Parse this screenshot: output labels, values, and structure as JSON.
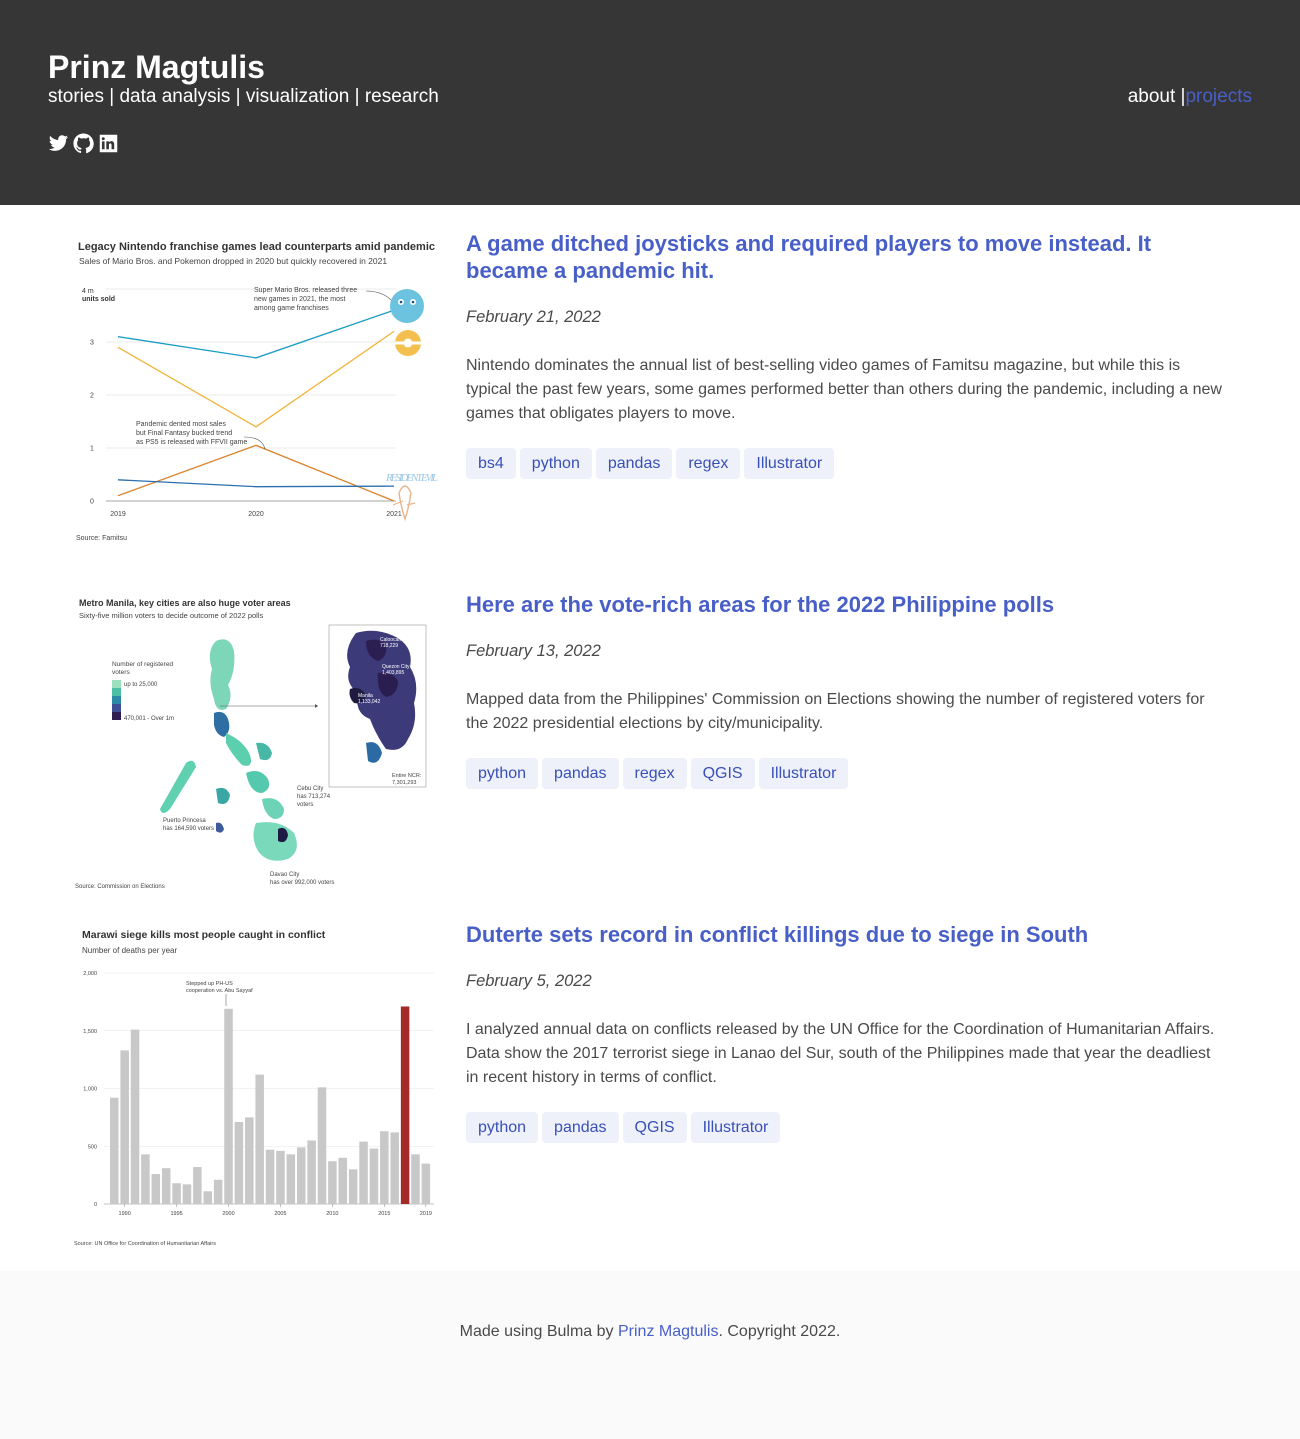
{
  "header": {
    "title": "Prinz Magtulis",
    "subtitle": "stories | data analysis | visualization | research",
    "nav": {
      "about": "about |",
      "projects": "projects"
    },
    "social_icons": [
      "twitter-icon",
      "github-icon",
      "linkedin-icon"
    ]
  },
  "posts": [
    {
      "title": "A game ditched joysticks and required players to move instead. It became a pandemic hit.",
      "date": "February 21, 2022",
      "description": "Nintendo dominates the annual list of best-selling video games of Famitsu magazine, but while this is typical the past few years, some games performed better than others during the pandemic, including a new games that obligates players to move.",
      "tags": [
        "bs4",
        "python",
        "pandas",
        "regex",
        "Illustrator"
      ],
      "thumbnail": {
        "title": "Legacy Nintendo franchise games lead counterparts amid pandemic",
        "subtitle": "Sales of Mario Bros. and Pokemon dropped in 2020 but quickly recovered in 2021",
        "ylabel_top": "4 m",
        "ylabel_unit": "units sold",
        "yticks": [
          "3",
          "2",
          "1",
          "0"
        ],
        "xticks": [
          "2019",
          "2020",
          "2021"
        ],
        "annotation_mario_1": "Super Mario Bros. released three",
        "annotation_mario_2": "new games in 2021, the most",
        "annotation_mario_3": "among game franchises",
        "annotation_ff_1": "Pandemic dented most sales",
        "annotation_ff_2": "but Final Fantasy bucked trend",
        "annotation_ff_3": "as PS5 is released with FFVII game",
        "logo_text": "RESIDENT EVIL",
        "source": "Source: Famitsu"
      }
    },
    {
      "title": "Here are the vote-rich areas for the 2022 Philippine polls",
      "date": "February 13, 2022",
      "description": "Mapped data from the Philippines' Commission on Elections showing the number of registered voters for the 2022 presidential elections by city/municipality.",
      "tags": [
        "python",
        "pandas",
        "regex",
        "QGIS",
        "Illustrator"
      ],
      "thumbnail": {
        "title": "Metro Manila, key cities are also huge voter areas",
        "subtitle": "Sixty-five million voters to decide outcome of 2022 polls",
        "legend_title_1": "Number of registered",
        "legend_title_2": "voters",
        "legend_low": "up to 25,000",
        "legend_high": "470,001 - Over 1m",
        "label_caloocan_1": "Caloocan",
        "label_caloocan_2": "718,229",
        "label_qc_1": "Quezon City",
        "label_qc_2": "1,403,895",
        "label_manila_1": "Manila",
        "label_manila_2": "1,133,042",
        "label_ncr_1": "Entire NCR:",
        "label_ncr_2": "7,301,293",
        "label_cebu_1": "Cebu City",
        "label_cebu_2": "has 713,274",
        "label_cebu_3": "voters",
        "label_puerto_1": "Puerto Princesa",
        "label_puerto_2": "has 164,590 voters",
        "label_davao_1": "Davao City",
        "label_davao_2": "has over 992,000 voters",
        "source": "Source: Commission on Elections"
      }
    },
    {
      "title": "Duterte sets record in conflict killings due to siege in South",
      "date": "February 5, 2022",
      "description": "I analyzed annual data on conflicts released by the UN Office for the Coordination of Humanitarian Affairs. Data show the 2017 terrorist siege in Lanao del Sur, south of the Philippines made that year the deadliest in recent history in terms of conflict.",
      "tags": [
        "python",
        "pandas",
        "QGIS",
        "Illustrator"
      ],
      "thumbnail": {
        "title": "Marawi siege kills most people caught in conflict",
        "subtitle": "Number of deaths per year",
        "annotation_1": "Stepped up PH-US",
        "annotation_2": "cooperation vs. Abu Sayyaf",
        "source": "Source: UN Office for Coordination of Humanitarian Affairs"
      }
    }
  ],
  "chart_data": [
    {
      "type": "line",
      "title": "Legacy Nintendo franchise games lead counterparts amid pandemic",
      "subtitle": "Sales of Mario Bros. and Pokemon dropped in 2020 but quickly recovered in 2021",
      "ylabel": "4 m units sold",
      "x": [
        "2019",
        "2020",
        "2021"
      ],
      "ylim": [
        0,
        4
      ],
      "series": [
        {
          "values": [
            3.1,
            2.7,
            3.6
          ],
          "color": "#1a9cc4"
        },
        {
          "values": [
            2.9,
            1.4,
            3.2
          ],
          "color": "#f0b43a"
        },
        {
          "values": [
            0.1,
            1.05,
            0.0
          ],
          "color": "#d9822b"
        },
        {
          "values": [
            0.4,
            0.27,
            0.28
          ],
          "color": "#2b6fb0"
        }
      ]
    },
    {
      "type": "bar",
      "title": "Marawi siege kills most people caught in conflict",
      "subtitle": "Number of deaths per year",
      "categories": [
        "1989",
        "1990",
        "1991",
        "1992",
        "1993",
        "1994",
        "1995",
        "1996",
        "1997",
        "1998",
        "1999",
        "2000",
        "2001",
        "2002",
        "2003",
        "2004",
        "2005",
        "2006",
        "2007",
        "2008",
        "2009",
        "2010",
        "2011",
        "2012",
        "2013",
        "2014",
        "2015",
        "2016",
        "2017",
        "2018",
        "2019"
      ],
      "values": [
        920,
        1330,
        1510,
        430,
        260,
        310,
        180,
        170,
        320,
        110,
        210,
        1690,
        710,
        750,
        1120,
        470,
        460,
        430,
        490,
        550,
        1010,
        370,
        400,
        300,
        540,
        480,
        630,
        620,
        1710,
        430,
        350
      ],
      "highlight_index": 28,
      "ylim": [
        0,
        2000
      ],
      "yticks": [
        "0",
        "500",
        "1,000",
        "1,500",
        "2,000"
      ],
      "xticks": [
        "1990",
        "1995",
        "2000",
        "2005",
        "2010",
        "2015",
        "2019"
      ],
      "bar_color": "#c8c8c8",
      "highlight_color": "#a42a2a"
    }
  ],
  "footer": {
    "prefix": "Made using Bulma by ",
    "author": "Prinz Magtulis",
    "suffix": ". Copyright 2022."
  }
}
